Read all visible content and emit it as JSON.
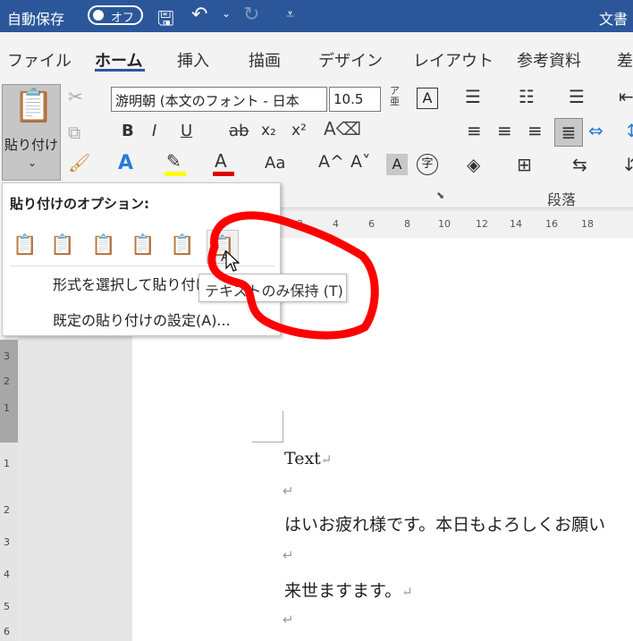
{
  "titlebar": {
    "autosave_label": "自動保存",
    "toggle_state": "オフ",
    "doc_title": "文書"
  },
  "tabs": [
    "ファイル",
    "ホーム",
    "挿入",
    "描画",
    "デザイン",
    "レイアウト",
    "参考資料",
    "差"
  ],
  "clipboard": {
    "paste_label": "貼り付け"
  },
  "font": {
    "name": "游明朝 (本文のフォント - 日本",
    "size": "10.5"
  },
  "ribbon": {
    "paragraph_group_label": "段落"
  },
  "paste_menu": {
    "title": "貼り付けのオプション:",
    "item_special": "形式を選択して貼り付け",
    "item_default": "既定の貼り付けの設定(A)..."
  },
  "tooltip": "テキストのみ保持 (T)",
  "ruler": {
    "ticks": [
      "2",
      "4",
      "6",
      "8",
      "10",
      "12",
      "14",
      "16",
      "18"
    ]
  },
  "vruler": {
    "ticks": [
      "3",
      "2",
      "1",
      "1",
      "2",
      "3",
      "4",
      "5",
      "6"
    ]
  },
  "document": {
    "line1": "Text",
    "line2": "はいお疲れ様です。本日もよろしくお願い",
    "line3": "来世ますます。"
  },
  "colors": {
    "title_bar": "#2b579a",
    "highlight": "#ffff00",
    "font_color": "#e00000",
    "annotation": "#ff0000"
  }
}
